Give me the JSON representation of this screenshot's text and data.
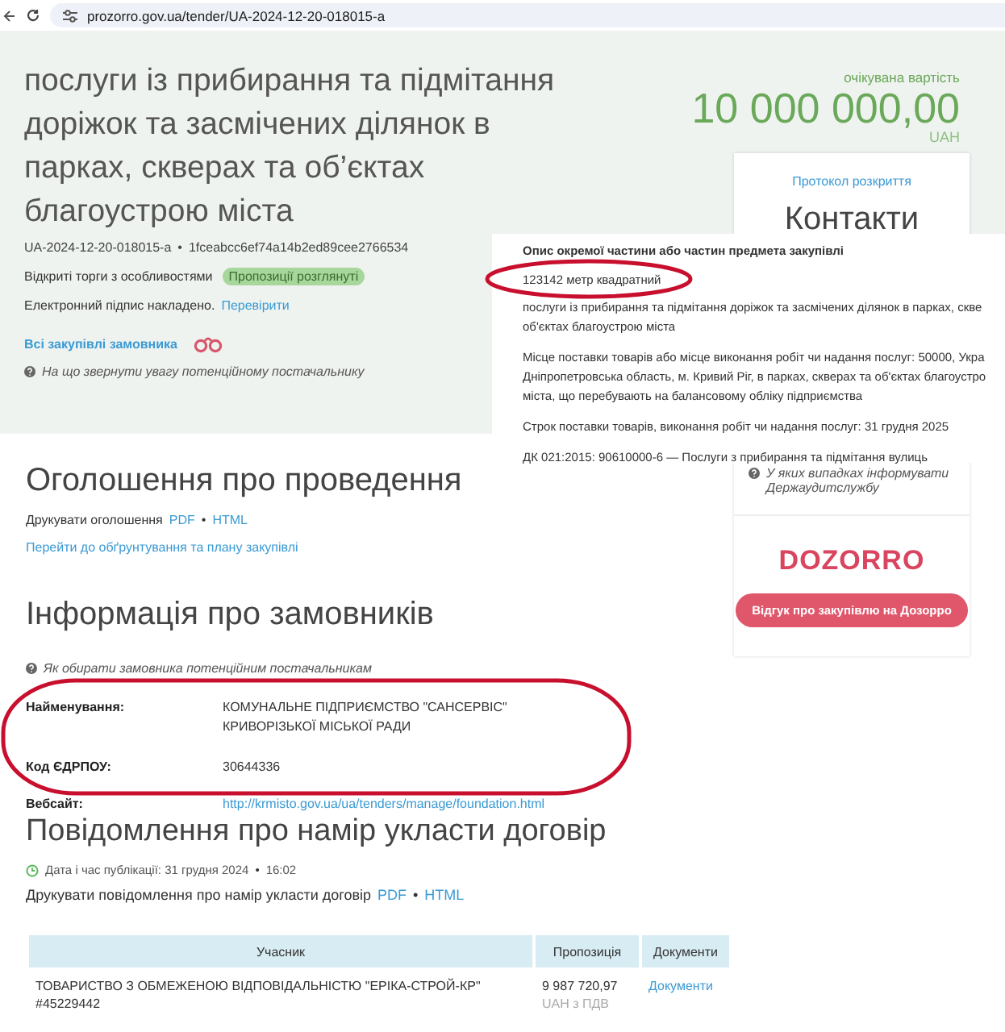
{
  "browser": {
    "url": "prozorro.gov.ua/tender/UA-2024-12-20-018015-a"
  },
  "tender": {
    "title": "послуги із прибирання та підмітання доріжок та засмічених ділянок в парках, скверах та об’єктах благоустрою міста",
    "id": "UA-2024-12-20-018015-a",
    "separator": "•",
    "hash": "1fceabcc6ef74a14b2ed89cee2766534",
    "procedure": "Відкриті торги з особливостями",
    "status_badge": "Пропозиції розглянуті",
    "signature": "Електронний підпис накладено.",
    "signature_link": "Перевірити",
    "buyer_link": "Всі закупівлі замовника",
    "hint": "На що звернути увагу потенційному постачальнику"
  },
  "price": {
    "label": "очікувана вартість",
    "amount": "10 000 000,00",
    "currency": "UAH"
  },
  "sidebar": {
    "protocol_link": "Протокол розкриття",
    "contacts_title": "Контакти",
    "audit_hint": "У яких випадках інформувати Держаудитслужбу",
    "logo": "DOZORRO",
    "feedback_button": "Відгук про закупівлю на Дозорро"
  },
  "lot_panel": {
    "heading": "Опис окремої частини або частин предмета закупівлі",
    "quantity": "123142 метр квадратний",
    "paragraphs": [
      [
        "послуги із прибирання та підмітання доріжок та засмічених ділянок в парках, скве",
        "об'єктах благоустрою міста"
      ],
      [
        "Місце поставки товарів або місце виконання робіт чи надання послуг: 50000, Укра",
        "Дніпропетровська область, м. Кривий Ріг, в парках, скверах та об'єктах благоустро",
        "міста, що перебувають на балансовому обліку підприємства"
      ],
      [
        "Строк поставки товарів, виконання робіт чи надання послуг: 31 грудня 2025"
      ],
      [
        "ДК 021:2015: 90610000-6 — Послуги з прибирання та підмітання вулиць"
      ]
    ]
  },
  "announcement": {
    "heading": "Оголошення про проведення",
    "print_label": "Друкувати оголошення",
    "pdf": "PDF",
    "separator": "•",
    "html": "HTML",
    "plan_link": "Перейти до обґрунтування та плану закупівлі"
  },
  "customers": {
    "heading": "Інформація про замовників",
    "hint": "Як обирати замовника потенційним постачальникам",
    "fields": [
      {
        "label": "Найменування:",
        "kind": "text",
        "value": [
          "КОМУНАЛЬНЕ ПІДПРИЄМСТВО \"САНСЕРВІС\"",
          "КРИВОРІЗЬКОЇ МІСЬКОЇ РАДИ"
        ]
      },
      {
        "label": "Код ЄДРПОУ:",
        "kind": "text",
        "value": [
          "30644336"
        ]
      },
      {
        "label": "Вебсайт:",
        "kind": "link",
        "value": [
          "http://krmisto.gov.ua/ua/tenders/manage/foundation.html"
        ]
      }
    ]
  },
  "contract_notice": {
    "heading": "Повідомлення про намір укласти договір",
    "date": "Дата і час публікації: 31 грудня 2024",
    "date_separator": "•",
    "time": "16:02",
    "print_label": "Друкувати повідомлення про намір укласти договір",
    "pdf": "PDF",
    "separator": "•",
    "html": "HTML"
  },
  "table": {
    "columns": [
      "Учасник",
      "Пропозиція",
      "Документи"
    ],
    "rows": [
      {
        "participant": "ТОВАРИСТВО З ОБМЕЖЕНОЮ ВІДПОВІДАЛЬНІСТЮ \"ЕРІКА-СТРОЙ-КР\"",
        "code": "#45229442",
        "amount": "9 987 720,97",
        "amount_note": "UAH з ПДВ",
        "documents": "Документи"
      }
    ]
  }
}
